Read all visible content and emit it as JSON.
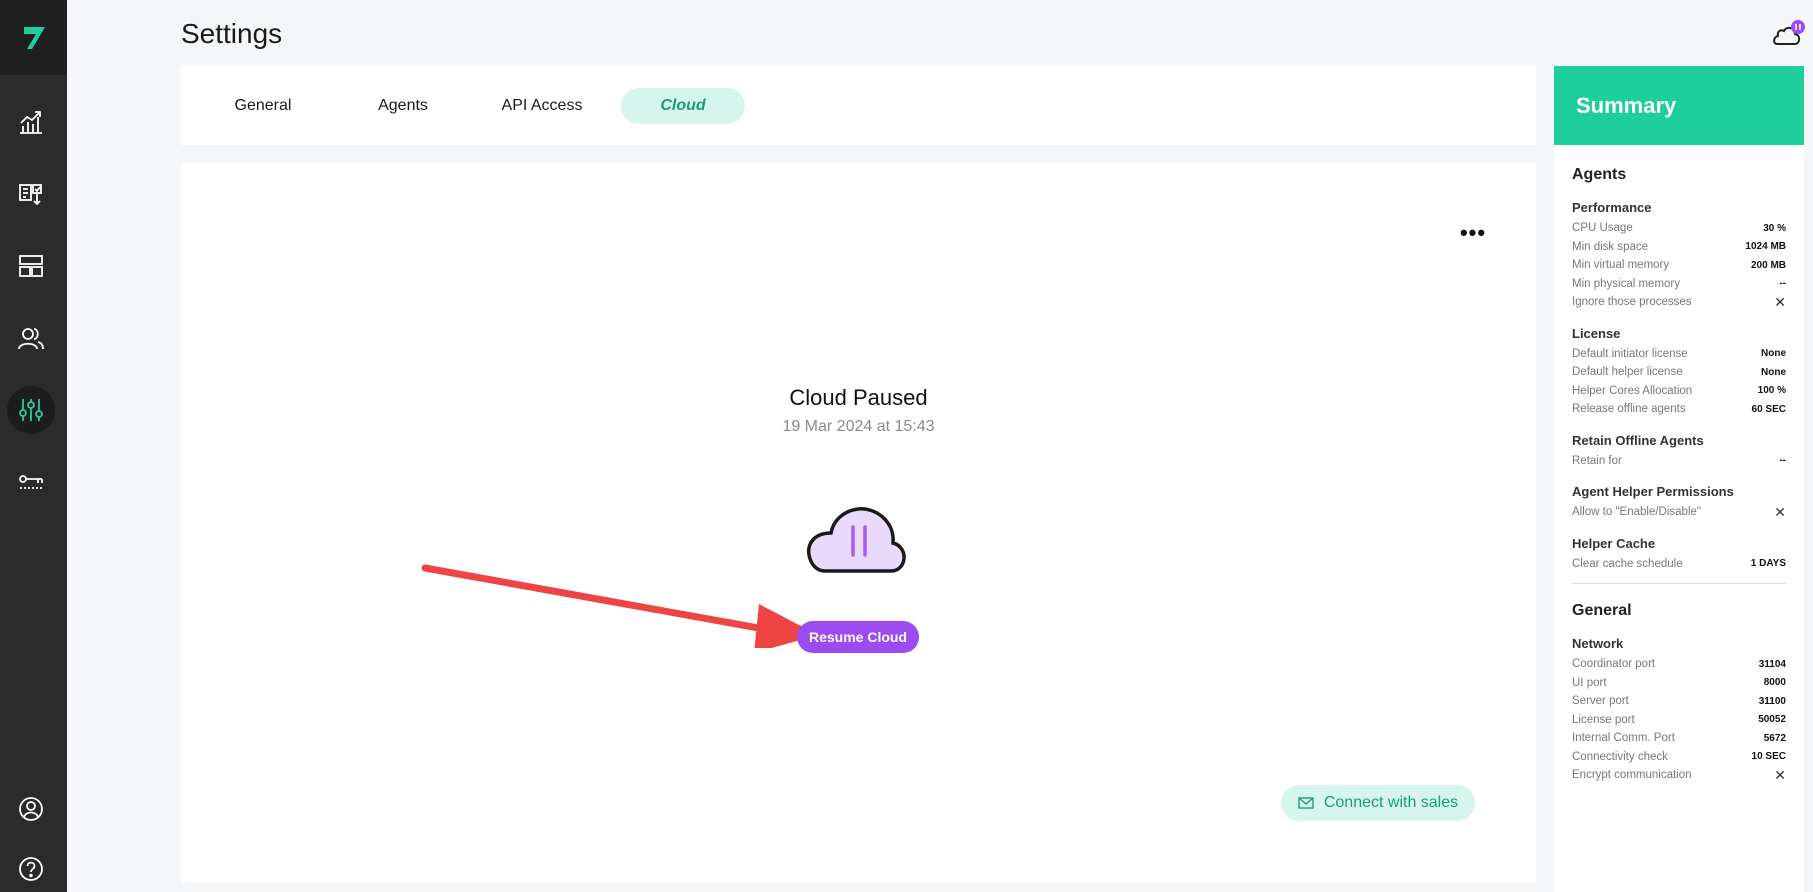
{
  "header": {
    "title": "Settings"
  },
  "tabs": [
    {
      "label": "General"
    },
    {
      "label": "Agents"
    },
    {
      "label": "API Access"
    },
    {
      "label": "Cloud",
      "active": true
    }
  ],
  "cloud": {
    "status_title": "Cloud Paused",
    "status_date": "19 Mar 2024 at 15:43",
    "resume_label": "Resume Cloud",
    "more_label": "•••",
    "sales_label": "Connect with sales"
  },
  "summary": {
    "title": "Summary",
    "agents": {
      "title": "Agents",
      "performance": {
        "title": "Performance",
        "rows": [
          {
            "k": "CPU Usage",
            "v": "30 %"
          },
          {
            "k": "Min disk space",
            "v": "1024 MB"
          },
          {
            "k": "Min virtual memory",
            "v": "200 MB"
          },
          {
            "k": "Min physical memory",
            "v": "--"
          },
          {
            "k": "Ignore those processes",
            "v": "✕"
          }
        ]
      },
      "license": {
        "title": "License",
        "rows": [
          {
            "k": "Default initiator license",
            "v": "None"
          },
          {
            "k": "Default helper license",
            "v": "None"
          },
          {
            "k": "Helper Cores Allocation",
            "v": "100 %"
          },
          {
            "k": "Release offline agents",
            "v": "60 SEC"
          }
        ]
      },
      "retain": {
        "title": "Retain Offline Agents",
        "rows": [
          {
            "k": "Retain for",
            "v": "--"
          }
        ]
      },
      "permissions": {
        "title": "Agent Helper Permissions",
        "rows": [
          {
            "k": "Allow to \"Enable/Disable\"",
            "v": "✕"
          }
        ]
      },
      "cache": {
        "title": "Helper Cache",
        "rows": [
          {
            "k": "Clear cache schedule",
            "v": "1 DAYS"
          }
        ]
      }
    },
    "general": {
      "title": "General",
      "network": {
        "title": "Network",
        "rows": [
          {
            "k": "Coordinator port",
            "v": "31104"
          },
          {
            "k": "UI port",
            "v": "8000"
          },
          {
            "k": "Server port",
            "v": "31100"
          },
          {
            "k": "License port",
            "v": "50052"
          },
          {
            "k": "Internal Comm. Port",
            "v": "5672"
          },
          {
            "k": "Connectivity check",
            "v": "10 SEC"
          },
          {
            "k": "Encrypt communication",
            "v": "✕"
          }
        ]
      }
    }
  },
  "sidebar": {
    "items": [
      {
        "icon": "analytics-icon"
      },
      {
        "icon": "jobs-icon"
      },
      {
        "icon": "layout-icon"
      },
      {
        "icon": "users-icon"
      },
      {
        "icon": "settings-sliders-icon",
        "active": true
      },
      {
        "icon": "key-icon"
      }
    ],
    "bottom": [
      {
        "icon": "profile-icon"
      },
      {
        "icon": "help-icon"
      }
    ]
  },
  "colors": {
    "accent": "#1ecf9c",
    "purple": "#9b4bf0",
    "sidebar": "#2b2b2b",
    "arrow": "#ef4444"
  }
}
